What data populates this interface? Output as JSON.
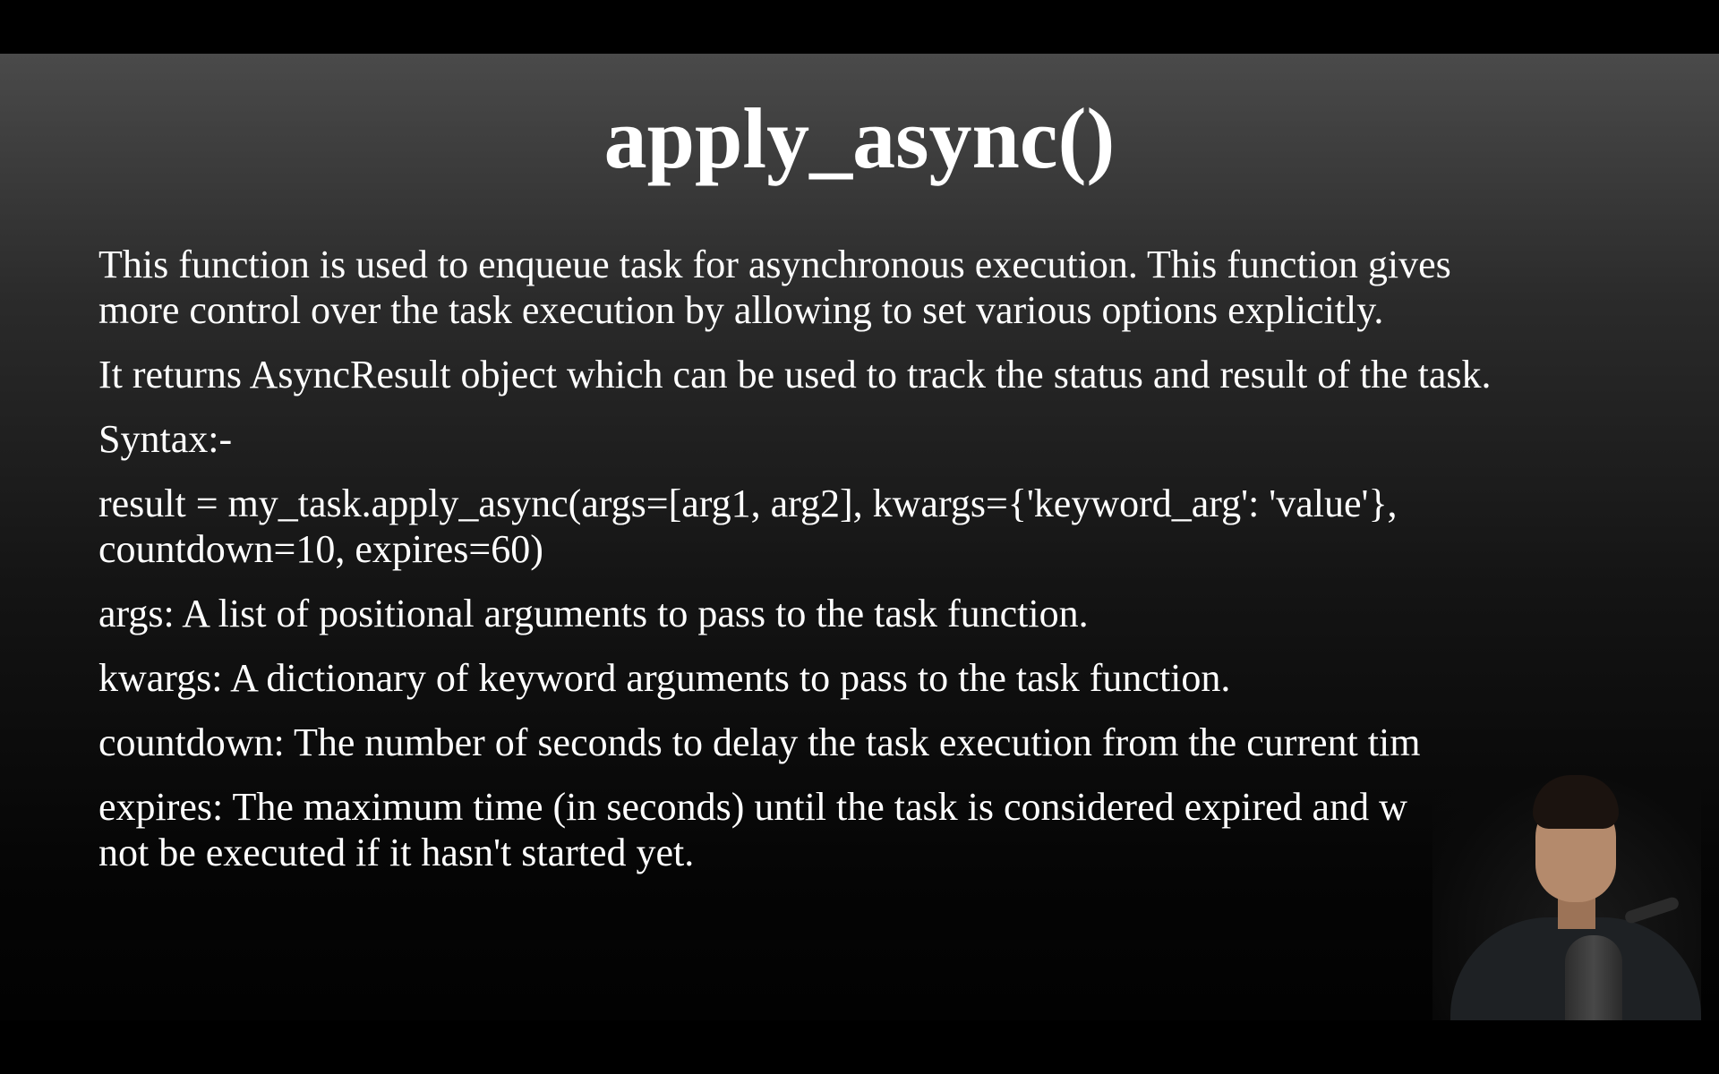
{
  "slide": {
    "title": "apply_async()",
    "paragraphs": [
      {
        "lines": [
          "This function is used to enqueue task for asynchronous execution. This function gives",
          "more control over the task execution by allowing to set various options explicitly."
        ]
      },
      {
        "lines": [
          "It returns AsyncResult object which can be used to track the status and result of the task."
        ]
      },
      {
        "lines": [
          "Syntax:-"
        ]
      },
      {
        "lines": [
          "result = my_task.apply_async(args=[arg1, arg2], kwargs={'keyword_arg': 'value'},",
          "countdown=10, expires=60)"
        ]
      },
      {
        "lines": [
          "args: A list of positional arguments to pass to the task function."
        ]
      },
      {
        "lines": [
          "kwargs: A dictionary of keyword arguments to pass to the task function."
        ]
      },
      {
        "lines": [
          "countdown: The number of seconds to delay the task execution from the current tim"
        ]
      },
      {
        "lines": [
          "expires: The maximum time (in seconds) until the task is considered expired and w",
          "not be executed if it hasn't started yet."
        ]
      }
    ]
  }
}
